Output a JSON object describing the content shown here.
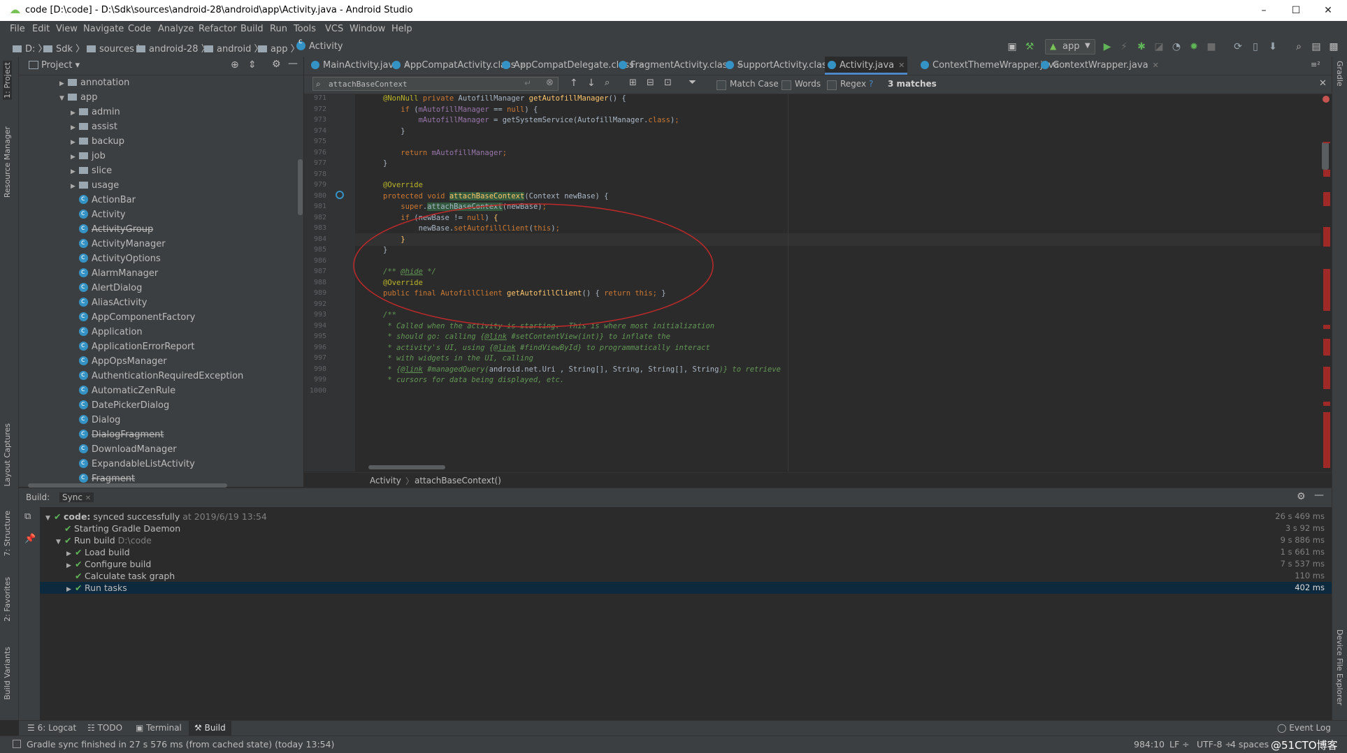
{
  "window": {
    "title": "code [D:\\code] - D:\\Sdk\\sources\\android-28\\android\\app\\Activity.java - Android Studio",
    "minimize": "–",
    "maximize": "☐",
    "close": "✕"
  },
  "menu": [
    "File",
    "Edit",
    "View",
    "Navigate",
    "Code",
    "Analyze",
    "Refactor",
    "Build",
    "Run",
    "Tools",
    "VCS",
    "Window",
    "Help"
  ],
  "breadcrumbs": [
    "D:",
    "Sdk",
    "sources",
    "android-28",
    "android",
    "app",
    "Activity"
  ],
  "run_config": "app",
  "left_tool_tabs": [
    "1: Project",
    "Resource Manager",
    "Layout Captures",
    "7: Structure",
    "2: Favorites",
    "Build Variants"
  ],
  "right_tool_tabs": [
    "Gradle",
    "Device File Explorer"
  ],
  "project": {
    "header": "Project",
    "tree": [
      {
        "label": "annotation",
        "kind": "folder",
        "level": 1,
        "arrow": "▶"
      },
      {
        "label": "app",
        "kind": "folder",
        "level": 1,
        "arrow": "▼"
      },
      {
        "label": "admin",
        "kind": "folder",
        "level": 2,
        "arrow": "▶"
      },
      {
        "label": "assist",
        "kind": "folder",
        "level": 2,
        "arrow": "▶"
      },
      {
        "label": "backup",
        "kind": "folder",
        "level": 2,
        "arrow": "▶"
      },
      {
        "label": "job",
        "kind": "folder",
        "level": 2,
        "arrow": "▶"
      },
      {
        "label": "slice",
        "kind": "folder",
        "level": 2,
        "arrow": "▶"
      },
      {
        "label": "usage",
        "kind": "folder",
        "level": 2,
        "arrow": "▶"
      },
      {
        "label": "ActionBar",
        "kind": "class",
        "level": 2
      },
      {
        "label": "Activity",
        "kind": "class",
        "level": 2
      },
      {
        "label": "ActivityGroup",
        "kind": "class",
        "level": 2,
        "deprecated": true
      },
      {
        "label": "ActivityManager",
        "kind": "class",
        "level": 2
      },
      {
        "label": "ActivityOptions",
        "kind": "class",
        "level": 2
      },
      {
        "label": "AlarmManager",
        "kind": "class",
        "level": 2
      },
      {
        "label": "AlertDialog",
        "kind": "class",
        "level": 2
      },
      {
        "label": "AliasActivity",
        "kind": "class",
        "level": 2
      },
      {
        "label": "AppComponentFactory",
        "kind": "class",
        "level": 2
      },
      {
        "label": "Application",
        "kind": "class",
        "level": 2
      },
      {
        "label": "ApplicationErrorReport",
        "kind": "class",
        "level": 2
      },
      {
        "label": "AppOpsManager",
        "kind": "class",
        "level": 2
      },
      {
        "label": "AuthenticationRequiredException",
        "kind": "class",
        "level": 2
      },
      {
        "label": "AutomaticZenRule",
        "kind": "class",
        "level": 2
      },
      {
        "label": "DatePickerDialog",
        "kind": "class",
        "level": 2
      },
      {
        "label": "Dialog",
        "kind": "class",
        "level": 2
      },
      {
        "label": "DialogFragment",
        "kind": "class",
        "level": 2,
        "deprecated": true
      },
      {
        "label": "DownloadManager",
        "kind": "class",
        "level": 2
      },
      {
        "label": "ExpandableListActivity",
        "kind": "class",
        "level": 2
      },
      {
        "label": "Fragment",
        "kind": "class",
        "level": 2,
        "deprecated": true
      }
    ]
  },
  "tabs": [
    {
      "label": "MainActivity.java",
      "active": false
    },
    {
      "label": "AppCompatActivity.class",
      "active": false
    },
    {
      "label": "AppCompatDelegate.class",
      "active": false
    },
    {
      "label": "FragmentActivity.class",
      "active": false
    },
    {
      "label": "SupportActivity.class",
      "active": false
    },
    {
      "label": "Activity.java",
      "active": true
    },
    {
      "label": "ContextThemeWrapper.java",
      "active": false
    },
    {
      "label": "ContextWrapper.java",
      "active": false
    }
  ],
  "search": {
    "query": "attachBaseContext",
    "match_case": "Match Case",
    "words": "Words",
    "regex": "Regex",
    "help": "?",
    "matches": "3 matches"
  },
  "editor": {
    "lines": [
      {
        "n": "971",
        "html": "<span class='an'>@NonNull</span> <span class='kw'>private</span> AutofillManager <span class='fn'>getAutofillManager</span>() {"
      },
      {
        "n": "972",
        "html": "    <span class='kw'>if</span> (<span class='fld'>mAutofillManager</span> == <span class='kw'>null</span>) {"
      },
      {
        "n": "973",
        "html": "        <span class='fld'>mAutofillManager</span> = getSystemService(AutofillManager.<span class='kw'>class</span>)<span class='kw'>;</span>"
      },
      {
        "n": "974",
        "html": "    }"
      },
      {
        "n": "975",
        "html": ""
      },
      {
        "n": "976",
        "html": "    <span class='kw'>return</span> <span class='fld'>mAutofillManager</span><span class='kw'>;</span>"
      },
      {
        "n": "977",
        "html": "}"
      },
      {
        "n": "978",
        "html": ""
      },
      {
        "n": "979",
        "html": "<span class='an'>@Override</span>"
      },
      {
        "n": "980",
        "html": "<span class='kw'>protected void</span> <span class='fn hl'>attachBaseContext</span>(Context newBase) {"
      },
      {
        "n": "981",
        "html": "    <span class='kw'>super</span>.<span class='hl'>attachBaseContext</span>(newBase)<span class='kw'>;</span>"
      },
      {
        "n": "982",
        "html": "    <span class='kw'>if</span> (newBase != <span class='kw'>null</span>) <span class='fn'>{</span>"
      },
      {
        "n": "983",
        "html": "        newBase.<span class='kw'>setAutofillClient</span>(<span class='kw'>this</span>)<span class='kw'>;</span>"
      },
      {
        "n": "984",
        "html": "    <span class='fn'>}</span>"
      },
      {
        "n": "985",
        "html": "}"
      },
      {
        "n": "986",
        "html": ""
      },
      {
        "n": "987",
        "html": "<span class='cm'>/** <u>@hide</u> */</span>"
      },
      {
        "n": "988",
        "html": "<span class='an'>@Override</span>"
      },
      {
        "n": "989",
        "html": "<span class='kw'>public final</span> <span class='kw'>AutofillClient</span> <span class='fn'>getAutofillClient</span>() { <span class='kw'>return this;</span> }"
      },
      {
        "n": "992",
        "html": ""
      },
      {
        "n": "993",
        "html": "<span class='cm'>/**</span>"
      },
      {
        "n": "994",
        "html": "<span class='cm'> * Called when the activity is starting.  This is where most initialization</span>"
      },
      {
        "n": "995",
        "html": "<span class='cm'> * should go: calling {<u>@link</u> #setContentView(int)} to inflate the</span>"
      },
      {
        "n": "996",
        "html": "<span class='cm'> * activity's UI, using {<u>@link</u> #findViewById} to programmatically interact</span>"
      },
      {
        "n": "997",
        "html": "<span class='cm'> * with widgets in the UI, calling</span>"
      },
      {
        "n": "998",
        "html": "<span class='cm'> * {<u>@link</u> #managedQuery(</span>android.net.Uri , String[], String, String[], String<span class='cm'>)} to retrieve</span>"
      },
      {
        "n": "999",
        "html": "<span class='cm'> * cursors for data being displayed, etc.</span>"
      },
      {
        "n": "1000",
        "html": ""
      }
    ],
    "breadcrumb": [
      "Activity",
      "attachBaseContext()"
    ]
  },
  "build": {
    "tabs": [
      "Build:",
      "Sync"
    ],
    "rows": [
      {
        "arrow": "▼",
        "indent": 0,
        "bold": "code:",
        "text": " synced successfully",
        "dim": " at 2019/6/19 13:54",
        "time": "26 s 469 ms"
      },
      {
        "arrow": "",
        "indent": 1,
        "bold": "",
        "text": "Starting Gradle Daemon",
        "dim": "",
        "time": "3 s 92 ms"
      },
      {
        "arrow": "▼",
        "indent": 1,
        "bold": "",
        "text": "Run build",
        "dim": " D:\\code",
        "time": "9 s 886 ms"
      },
      {
        "arrow": "▶",
        "indent": 2,
        "bold": "",
        "text": "Load build",
        "dim": "",
        "time": "1 s 661 ms"
      },
      {
        "arrow": "▶",
        "indent": 2,
        "bold": "",
        "text": "Configure build",
        "dim": "",
        "time": "7 s 537 ms"
      },
      {
        "arrow": "",
        "indent": 2,
        "bold": "",
        "text": "Calculate task graph",
        "dim": "",
        "time": "110 ms"
      },
      {
        "arrow": "▶",
        "indent": 2,
        "bold": "",
        "text": "Run tasks",
        "dim": "",
        "time": "402 ms",
        "selected": true
      }
    ]
  },
  "bottom_tabs": [
    "6: Logcat",
    "TODO",
    "Terminal",
    "Build"
  ],
  "event_log": "Event Log",
  "status": {
    "message": "Gradle sync finished in 27 s 576 ms (from cached state) (today 13:54)",
    "position": "984:10",
    "line_sep": "LF ÷",
    "encoding": "UTF-8 ÷",
    "indent": "4 spaces",
    "watermark": "@51CTO博客"
  },
  "colors": {
    "accent": "#4a88c7",
    "annotation_circle": "#c0292a",
    "success": "#5fb558"
  }
}
